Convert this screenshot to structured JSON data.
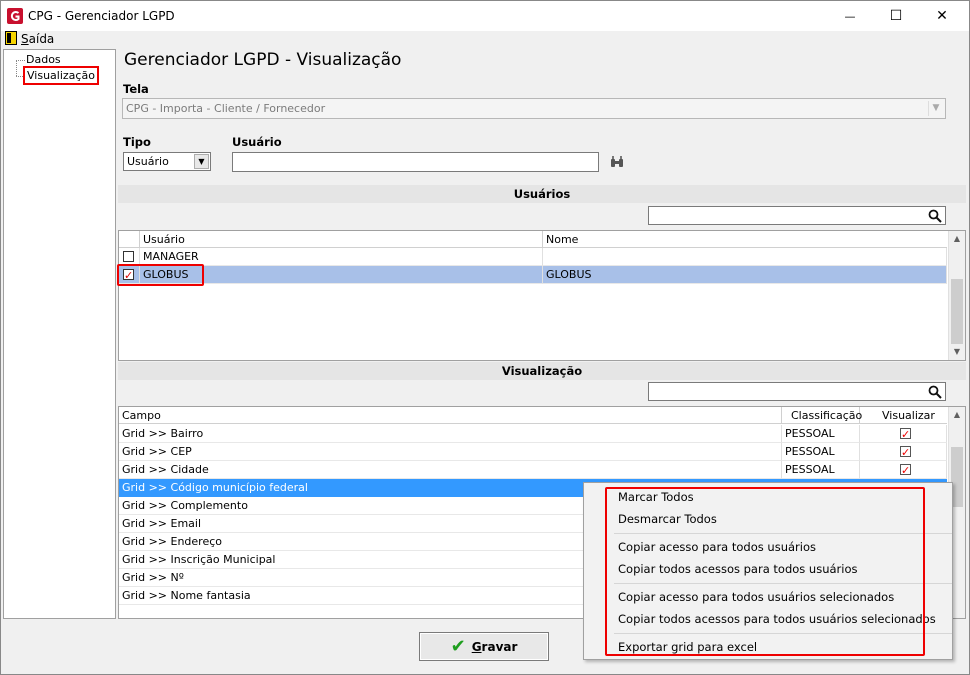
{
  "window": {
    "title": "CPG - Gerenciador LGPD",
    "minimize": "—",
    "maximize": "☐",
    "close": "✕"
  },
  "menu": {
    "exit_prefix": "S",
    "exit_rest": "aída"
  },
  "tree": {
    "items": [
      "Dados",
      "Visualização"
    ]
  },
  "page_title": "Gerenciador LGPD - Visualização",
  "form": {
    "tela_label": "Tela",
    "tela_value": "CPG - Importa - Cliente / Fornecedor",
    "tipo_label": "Tipo",
    "tipo_value": "Usuário",
    "usuario_label": "Usuário",
    "usuario_value": ""
  },
  "users_section": {
    "title": "Usuários",
    "columns": [
      "Usuário",
      "Nome"
    ],
    "rows": [
      {
        "checked": false,
        "usuario": "MANAGER",
        "nome": ""
      },
      {
        "checked": true,
        "usuario": "GLOBUS",
        "nome": "GLOBUS"
      }
    ]
  },
  "view_section": {
    "title": "Visualização",
    "columns": [
      "Campo",
      "Classificação",
      "Visualizar"
    ],
    "rows": [
      {
        "campo": "Grid >> Bairro",
        "classificacao": "PESSOAL",
        "visualizar": true
      },
      {
        "campo": "Grid >> CEP",
        "classificacao": "PESSOAL",
        "visualizar": true
      },
      {
        "campo": "Grid >> Cidade",
        "classificacao": "PESSOAL",
        "visualizar": true
      },
      {
        "campo": "Grid >> Código município federal",
        "classificacao": "",
        "visualizar": false
      },
      {
        "campo": "Grid >> Complemento",
        "classificacao": "",
        "visualizar": false
      },
      {
        "campo": "Grid >> Email",
        "classificacao": "",
        "visualizar": false
      },
      {
        "campo": "Grid >> Endereço",
        "classificacao": "",
        "visualizar": false
      },
      {
        "campo": "Grid >> Inscrição Municipal",
        "classificacao": "",
        "visualizar": false
      },
      {
        "campo": "Grid >> Nº",
        "classificacao": "",
        "visualizar": false
      },
      {
        "campo": "Grid >> Nome fantasia",
        "classificacao": "",
        "visualizar": false
      }
    ]
  },
  "context_menu": {
    "items": [
      "Marcar Todos",
      "Desmarcar Todos",
      "Copiar acesso para todos usuários",
      "Copiar todos acessos para todos usuários",
      "Copiar acesso para todos usuários selecionados",
      "Copiar todos acessos para todos usuários selecionados",
      "Exportar grid para excel"
    ]
  },
  "save_button": {
    "label_first": "G",
    "label_rest": "ravar"
  },
  "colors": {
    "selection_light": "#a8c0e8",
    "selection_blue": "#3399ff",
    "highlight_red": "#e00000"
  }
}
